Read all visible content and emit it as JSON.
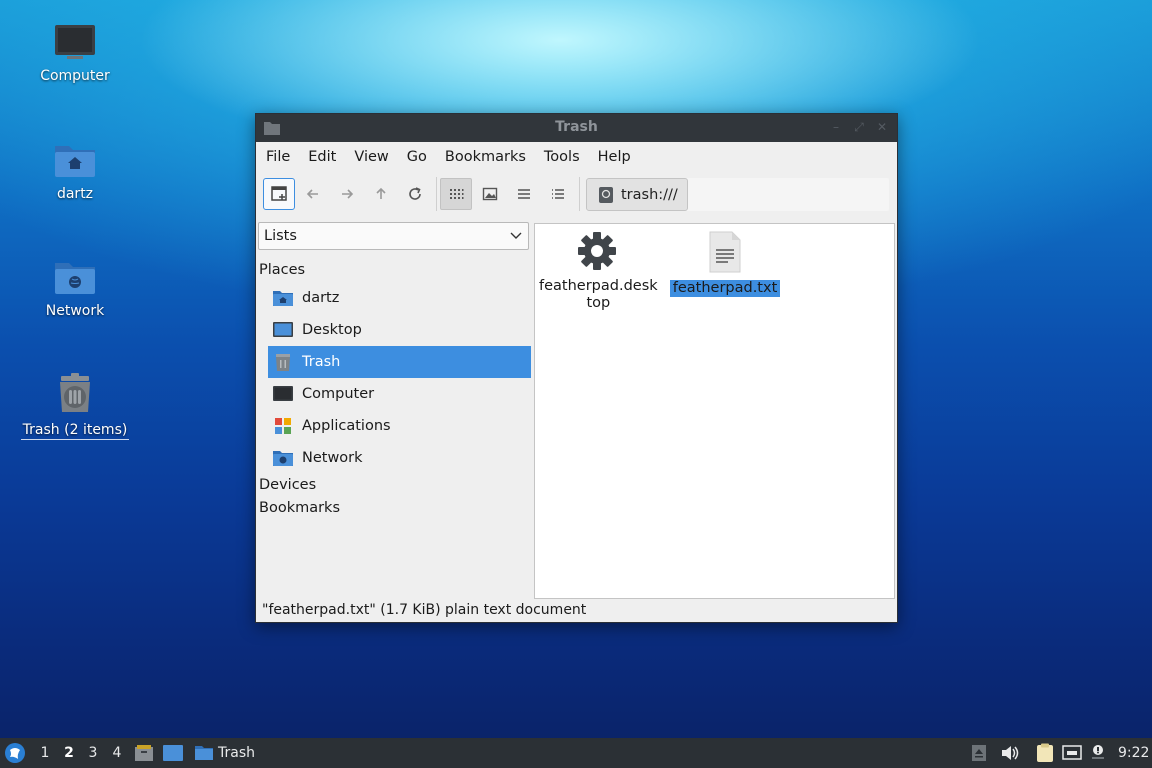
{
  "desktop": {
    "icons": [
      {
        "label": "Computer",
        "icon": "monitor-icon"
      },
      {
        "label": "dartz",
        "icon": "home-folder-icon"
      },
      {
        "label": "Network",
        "icon": "network-folder-icon"
      },
      {
        "label": "Trash (2 items)",
        "icon": "trash-icon"
      }
    ]
  },
  "window": {
    "title": "Trash",
    "menu": [
      "File",
      "Edit",
      "View",
      "Go",
      "Bookmarks",
      "Tools",
      "Help"
    ],
    "location": "trash:///",
    "side_pane": {
      "mode": "Lists",
      "sections": {
        "places": "Places",
        "devices": "Devices",
        "bookmarks": "Bookmarks"
      },
      "places": [
        {
          "label": "dartz",
          "icon": "home-folder-icon"
        },
        {
          "label": "Desktop",
          "icon": "desktop-icon"
        },
        {
          "label": "Trash",
          "icon": "trash-icon",
          "selected": true
        },
        {
          "label": "Computer",
          "icon": "monitor-icon"
        },
        {
          "label": "Applications",
          "icon": "applications-icon"
        },
        {
          "label": "Network",
          "icon": "network-folder-icon"
        }
      ]
    },
    "files": [
      {
        "name_line1": "featherpad.desk",
        "name_line2": "top",
        "icon": "gear-icon"
      },
      {
        "name": "featherpad.txt",
        "icon": "text-file-icon",
        "selected": true
      }
    ],
    "status": "\"featherpad.txt\" (1.7 KiB) plain text document"
  },
  "panel": {
    "workspaces": [
      "1",
      "2",
      "3",
      "4"
    ],
    "active_workspace": "2",
    "task_label": "Trash",
    "clock": "9:22"
  },
  "colors": {
    "accent": "#3d8ee0",
    "titlebar": "#31363b",
    "panel": "#2b3035"
  }
}
